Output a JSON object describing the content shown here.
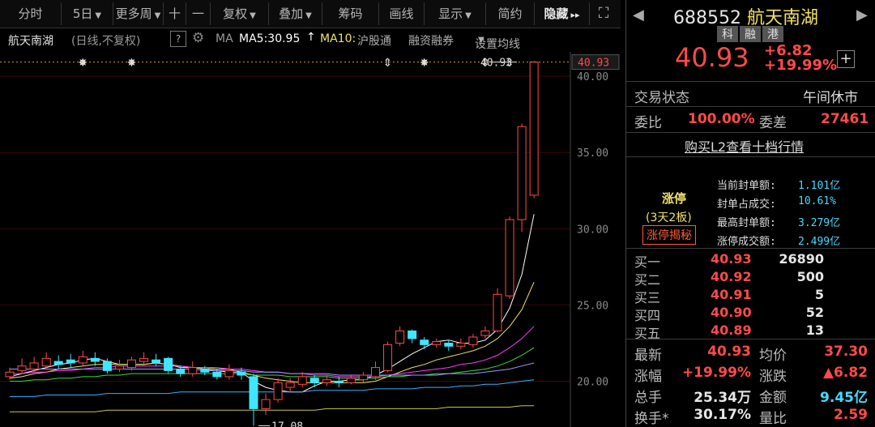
{
  "toolbar": {
    "items": [
      {
        "label": "分时"
      },
      {
        "label": "5日",
        "caret": "▼"
      },
      {
        "label": "更多周",
        "caret": "▼"
      },
      {
        "label": "十"
      },
      {
        "label": "一"
      },
      {
        "label": "复权",
        "caret": "▼"
      },
      {
        "label": "叠加",
        "caret": "▼"
      },
      {
        "label": "筹码"
      },
      {
        "label": "画线"
      },
      {
        "label": "显示",
        "caret": "▼"
      },
      {
        "label": "简约"
      }
    ],
    "hide_label": "隐藏",
    "hide_arrows": "▸▸",
    "fullscreen_icon": "⛶"
  },
  "legend": {
    "stock": "航天南湖",
    "mode": "(日线,不复权)",
    "help": "?",
    "ma": "MA",
    "ma5": "MA5:30.95",
    "ma10": "MA10:",
    "hgt": "沪股通",
    "rzrq": "融资融券",
    "setting": "设置均线",
    "setting_caret": "▼"
  },
  "colors": {
    "up": "#ff4a4a",
    "down": "#3fe6ff",
    "ma5": "#ffffff",
    "ma10": "#f0e06a",
    "ma20": "#ff3cff",
    "ma30": "#3ed93e",
    "ma60": "#9c9cff",
    "ma120": "#3ab0ff",
    "ma250": "#c8c84a"
  },
  "chart_data": {
    "type": "candlestick",
    "y_ticks": [
      "40.00",
      "35.00",
      "30.00",
      "25.00",
      "20.00"
    ],
    "ylim": [
      17.0,
      41.6
    ],
    "last_price_label": "40.93",
    "high_label": "40.93",
    "high_value": 40.93,
    "low_label": "17.08",
    "low_value": 17.08,
    "low_index": 20,
    "high_index": 42,
    "candles": [
      [
        20.3,
        20.6,
        20.1,
        20.9
      ],
      [
        20.7,
        21.0,
        20.5,
        21.5
      ],
      [
        20.8,
        21.2,
        20.6,
        21.6
      ],
      [
        21.0,
        21.5,
        20.8,
        21.9
      ],
      [
        21.3,
        21.1,
        20.8,
        21.7
      ],
      [
        21.4,
        21.2,
        20.9,
        21.8
      ],
      [
        21.2,
        21.6,
        21.0,
        22.0
      ],
      [
        21.5,
        21.3,
        21.0,
        21.9
      ],
      [
        21.3,
        20.7,
        20.5,
        21.5
      ],
      [
        20.8,
        21.0,
        20.6,
        21.4
      ],
      [
        20.9,
        21.4,
        20.7,
        21.6
      ],
      [
        21.3,
        21.5,
        21.0,
        21.9
      ],
      [
        21.4,
        21.2,
        21.0,
        21.8
      ],
      [
        21.5,
        20.7,
        20.5,
        21.6
      ],
      [
        20.8,
        20.5,
        20.3,
        21.0
      ],
      [
        20.5,
        20.9,
        20.3,
        21.3
      ],
      [
        20.8,
        20.6,
        20.4,
        21.0
      ],
      [
        20.6,
        20.3,
        20.1,
        20.8
      ],
      [
        20.3,
        20.7,
        20.1,
        21.1
      ],
      [
        20.6,
        20.4,
        20.1,
        20.9
      ],
      [
        20.3,
        18.2,
        17.08,
        20.5
      ],
      [
        18.2,
        18.8,
        17.8,
        19.2
      ],
      [
        18.8,
        19.9,
        18.6,
        20.2
      ],
      [
        19.6,
        19.9,
        19.3,
        20.2
      ],
      [
        19.8,
        20.3,
        19.6,
        20.6
      ],
      [
        20.2,
        19.9,
        19.6,
        20.4
      ],
      [
        19.9,
        20.1,
        19.7,
        20.4
      ],
      [
        20.0,
        19.9,
        19.6,
        20.3
      ],
      [
        19.9,
        20.2,
        19.8,
        20.4
      ],
      [
        20.1,
        20.4,
        19.9,
        20.6
      ],
      [
        20.3,
        20.9,
        20.1,
        21.3
      ],
      [
        20.7,
        22.4,
        20.6,
        22.6
      ],
      [
        22.5,
        23.3,
        22.3,
        23.6
      ],
      [
        23.3,
        22.8,
        22.5,
        23.4
      ],
      [
        22.7,
        22.4,
        22.1,
        22.9
      ],
      [
        22.4,
        22.6,
        22.2,
        22.8
      ],
      [
        22.5,
        22.3,
        22.0,
        22.7
      ],
      [
        22.3,
        22.5,
        22.1,
        22.8
      ],
      [
        22.4,
        22.9,
        22.2,
        23.1
      ],
      [
        23.0,
        23.3,
        22.8,
        23.6
      ],
      [
        23.3,
        25.7,
        23.2,
        26.1
      ],
      [
        25.6,
        30.6,
        25.4,
        30.8
      ],
      [
        30.6,
        36.7,
        29.8,
        36.9
      ],
      [
        32.2,
        40.93,
        32.0,
        41.0
      ]
    ],
    "ma_lines": {
      "ma5": [
        20.3,
        20.5,
        20.7,
        20.9,
        21.1,
        21.2,
        21.4,
        21.5,
        21.3,
        21.1,
        21.1,
        21.1,
        21.2,
        21.1,
        20.9,
        20.9,
        20.8,
        20.7,
        20.6,
        20.6,
        20.0,
        19.6,
        19.4,
        19.3,
        19.3,
        19.7,
        20.0,
        20.0,
        20.1,
        20.1,
        20.4,
        20.8,
        21.3,
        21.8,
        22.2,
        22.6,
        22.7,
        22.5,
        22.5,
        22.7,
        23.4,
        24.8,
        27.0,
        30.95
      ],
      "ma10": [
        20.2,
        20.3,
        20.5,
        20.6,
        20.8,
        20.9,
        21.0,
        21.1,
        21.1,
        21.1,
        21.1,
        21.1,
        21.2,
        21.1,
        21.0,
        20.9,
        20.9,
        20.8,
        20.8,
        20.6,
        20.4,
        20.2,
        20.1,
        20.0,
        19.9,
        19.9,
        19.9,
        19.9,
        19.9,
        19.9,
        20.0,
        20.3,
        20.6,
        20.9,
        21.1,
        21.4,
        21.6,
        21.8,
        22.0,
        22.3,
        22.8,
        23.6,
        24.7,
        26.5
      ],
      "ma20": [
        20.5,
        20.5,
        20.6,
        20.6,
        20.7,
        20.7,
        20.8,
        20.9,
        20.9,
        21.0,
        21.0,
        21.0,
        21.0,
        21.0,
        21.0,
        20.9,
        20.9,
        20.9,
        20.8,
        20.8,
        20.7,
        20.6,
        20.6,
        20.5,
        20.5,
        20.4,
        20.4,
        20.3,
        20.3,
        20.3,
        20.3,
        20.4,
        20.5,
        20.6,
        20.7,
        20.8,
        20.9,
        21.1,
        21.2,
        21.4,
        21.7,
        22.2,
        22.8,
        23.6
      ],
      "ma30": [
        20.0,
        20.0,
        20.1,
        20.1,
        20.2,
        20.2,
        20.3,
        20.3,
        20.4,
        20.4,
        20.5,
        20.5,
        20.5,
        20.5,
        20.5,
        20.5,
        20.5,
        20.5,
        20.5,
        20.5,
        20.4,
        20.4,
        20.4,
        20.3,
        20.3,
        20.3,
        20.3,
        20.2,
        20.2,
        20.2,
        20.2,
        20.3,
        20.3,
        20.4,
        20.4,
        20.5,
        20.5,
        20.6,
        20.7,
        20.8,
        21.0,
        21.3,
        21.7,
        22.2
      ],
      "ma60": [
        20.8,
        20.8,
        20.8,
        20.8,
        20.8,
        20.8,
        20.8,
        20.8,
        20.8,
        20.8,
        20.8,
        20.8,
        20.8,
        20.8,
        20.8,
        20.8,
        20.7,
        20.7,
        20.7,
        20.7,
        20.6,
        20.6,
        20.6,
        20.5,
        20.5,
        20.5,
        20.5,
        20.4,
        20.4,
        20.4,
        20.4,
        20.4,
        20.4,
        20.4,
        20.4,
        20.4,
        20.5,
        20.5,
        20.5,
        20.6,
        20.7,
        20.8,
        21.0,
        21.2
      ],
      "ma120": [
        19.0,
        19.0,
        19.0,
        19.1,
        19.1,
        19.1,
        19.1,
        19.1,
        19.2,
        19.2,
        19.2,
        19.2,
        19.2,
        19.2,
        19.3,
        19.3,
        19.3,
        19.3,
        19.3,
        19.3,
        19.3,
        19.3,
        19.3,
        19.3,
        19.3,
        19.4,
        19.4,
        19.4,
        19.4,
        19.4,
        19.5,
        19.5,
        19.5,
        19.5,
        19.6,
        19.6,
        19.6,
        19.7,
        19.7,
        19.8,
        19.8,
        19.9,
        20.0,
        20.1
      ],
      "ma250": [
        18.0,
        18.0,
        18.0,
        18.0,
        18.0,
        18.0,
        18.0,
        18.0,
        18.1,
        18.1,
        18.1,
        18.1,
        18.1,
        18.1,
        18.1,
        18.1,
        18.1,
        18.1,
        18.1,
        18.1,
        18.1,
        18.1,
        18.1,
        18.1,
        18.1,
        18.1,
        18.2,
        18.2,
        18.2,
        18.2,
        18.2,
        18.2,
        18.2,
        18.2,
        18.2,
        18.2,
        18.3,
        18.3,
        18.3,
        18.3,
        18.3,
        18.3,
        18.4,
        18.4
      ]
    },
    "markers": [
      {
        "index": 6,
        "symbol": "✸"
      },
      {
        "index": 10,
        "symbol": "✸"
      },
      {
        "index": 31,
        "symbol": "⇕"
      },
      {
        "index": 34,
        "symbol": "✸"
      },
      {
        "index": 39,
        "symbol": "⇕"
      },
      {
        "index": 41,
        "symbol": "⇕"
      }
    ]
  },
  "panel": {
    "code": "688552",
    "name": "航天南湖",
    "tags": [
      "科",
      "融",
      "港"
    ],
    "price": "40.93",
    "change": "+6.82",
    "pct": "+19.99%",
    "plus": "+",
    "status_label": "交易状态",
    "status_value": "午间休市",
    "wb_label": "委比",
    "wb_value": "100.00%",
    "wc_label": "委差",
    "wc_value": "27461",
    "l2_link": "购买L2查看十档行情",
    "limit_title": "涨停",
    "limit_sub": "(3天2板)",
    "limit_button": "涨停揭秘",
    "limit_stats": [
      {
        "label": "当前封单额:",
        "value": "1.101亿"
      },
      {
        "label": "封单占成交:",
        "value": "10.61%"
      },
      {
        "label": "最高封单额:",
        "value": "3.279亿"
      },
      {
        "label": "涨停成交额:",
        "value": "2.499亿"
      }
    ],
    "bids": [
      {
        "label": "买一",
        "price": "40.93",
        "vol": "26890"
      },
      {
        "label": "买二",
        "price": "40.92",
        "vol": "500"
      },
      {
        "label": "买三",
        "price": "40.91",
        "vol": "5"
      },
      {
        "label": "买四",
        "price": "40.90",
        "vol": "52"
      },
      {
        "label": "买五",
        "price": "40.89",
        "vol": "13"
      }
    ],
    "stats": [
      {
        "l1": "最新",
        "v1": "40.93",
        "c1": "red",
        "l2": "均价",
        "v2": "37.30",
        "c2": "red"
      },
      {
        "l1": "涨幅",
        "v1": "+19.99%",
        "c1": "red",
        "l2": "涨跌",
        "v2": "▲6.82",
        "c2": "red"
      },
      {
        "l1": "总手",
        "v1": "25.34万",
        "c1": "white",
        "l2": "金额",
        "v2": "9.45亿",
        "c2": "cyan"
      },
      {
        "l1": "换手*",
        "v1": "30.17%",
        "c1": "white",
        "l2": "量比",
        "v2": "2.59",
        "c2": "red"
      }
    ]
  }
}
